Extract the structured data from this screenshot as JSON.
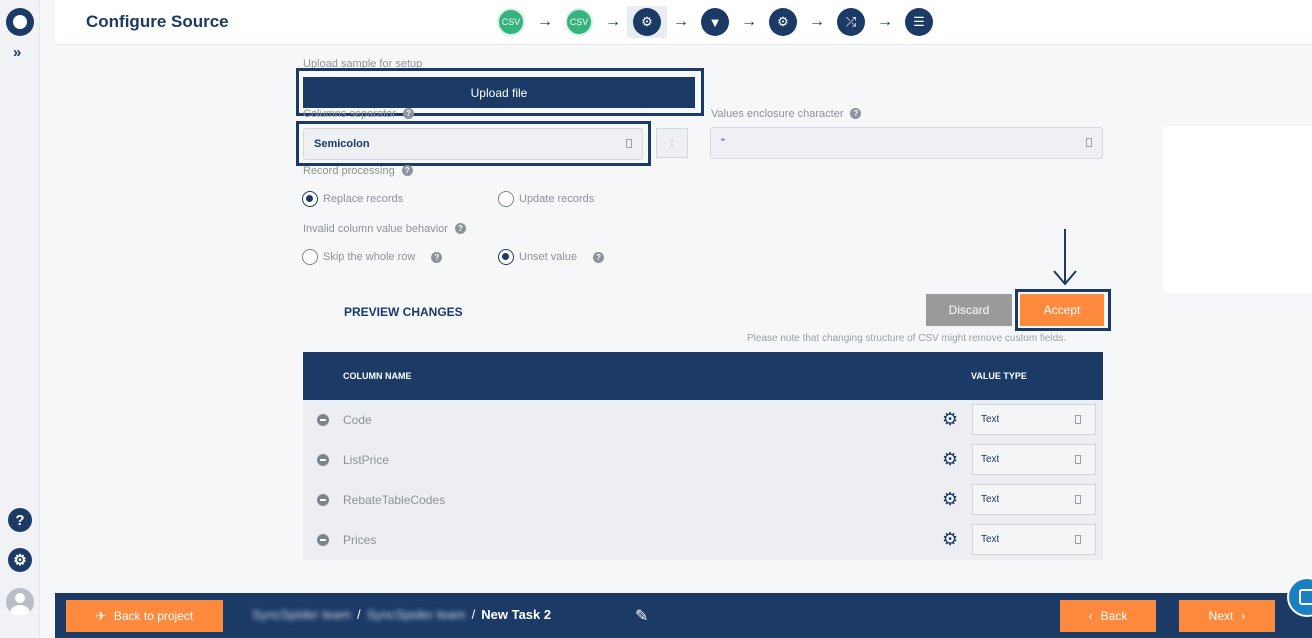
{
  "header": {
    "title": "Configure Source",
    "steps": [
      {
        "label": "CSV",
        "icon": "csv-icon"
      },
      {
        "label": "CSV",
        "icon": "csv-icon"
      },
      {
        "label": "",
        "icon": "gear-icon"
      },
      {
        "label": "",
        "icon": "filter-icon"
      },
      {
        "label": "",
        "icon": "gear-icon"
      },
      {
        "label": "",
        "icon": "shuffle-icon"
      },
      {
        "label": "",
        "icon": "sliders-icon"
      }
    ]
  },
  "form": {
    "upload_label": "Upload sample for setup",
    "upload_button": "Upload file",
    "separator_label": "Columns separator",
    "separator_value": "Semicolon",
    "separator_char": ":",
    "enclosure_label": "Values enclosure character",
    "enclosure_value": "\"",
    "record_processing_label": "Record processing",
    "replace_records": "Replace records",
    "update_records": "Update records",
    "invalid_label": "Invalid column value behavior",
    "skip_row": "Skip the whole row",
    "unset_value": "Unset value"
  },
  "preview": {
    "title": "PREVIEW CHANGES",
    "discard": "Discard",
    "accept": "Accept",
    "note": "Please note that changing structure of CSV might remove custom fields.",
    "col_name_header": "COLUMN NAME",
    "value_type_header": "VALUE TYPE",
    "rows": [
      {
        "name": "Code",
        "type": "Text"
      },
      {
        "name": "ListPrice",
        "type": "Text"
      },
      {
        "name": "RebateTableCodes",
        "type": "Text"
      },
      {
        "name": "Prices",
        "type": "Text"
      }
    ]
  },
  "footer": {
    "back_to_project": "Back to project",
    "crumb1": "SyncSpider team",
    "crumb2": "SyncSpider team",
    "task": "New Task 2",
    "back": "Back",
    "next": "Next"
  },
  "colors": {
    "navy": "#1b3a66",
    "orange": "#ff8a3d",
    "green": "#36b37e"
  }
}
